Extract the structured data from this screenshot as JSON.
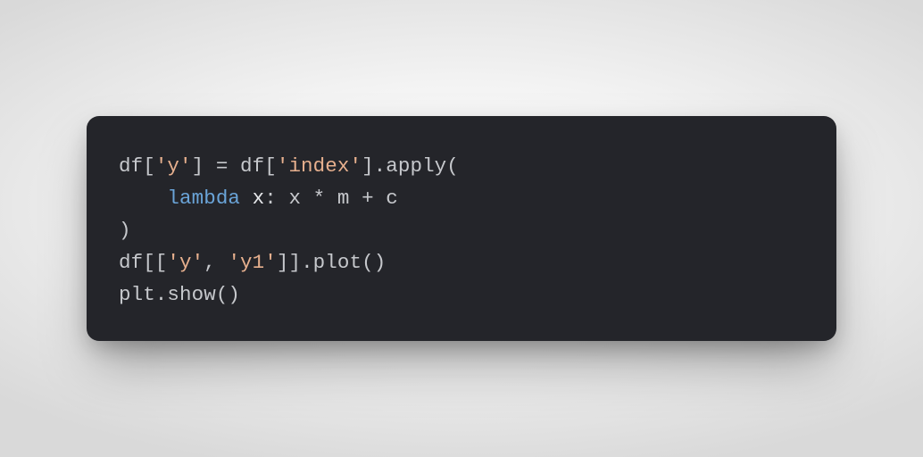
{
  "code": {
    "l1a": "df[",
    "l1b": "'y'",
    "l1c": "] = df[",
    "l1d": "'index'",
    "l1e": "].apply(",
    "l2_indent": "    ",
    "l2_kw": "lambda",
    "l2_sp": " ",
    "l2_param": "x",
    "l2_rest": ": x * m + c",
    "l3": ")",
    "l4a": "df[[",
    "l4b": "'y'",
    "l4c": ", ",
    "l4d": "'y1'",
    "l4e": "]].plot()",
    "l5": "plt.show()"
  }
}
